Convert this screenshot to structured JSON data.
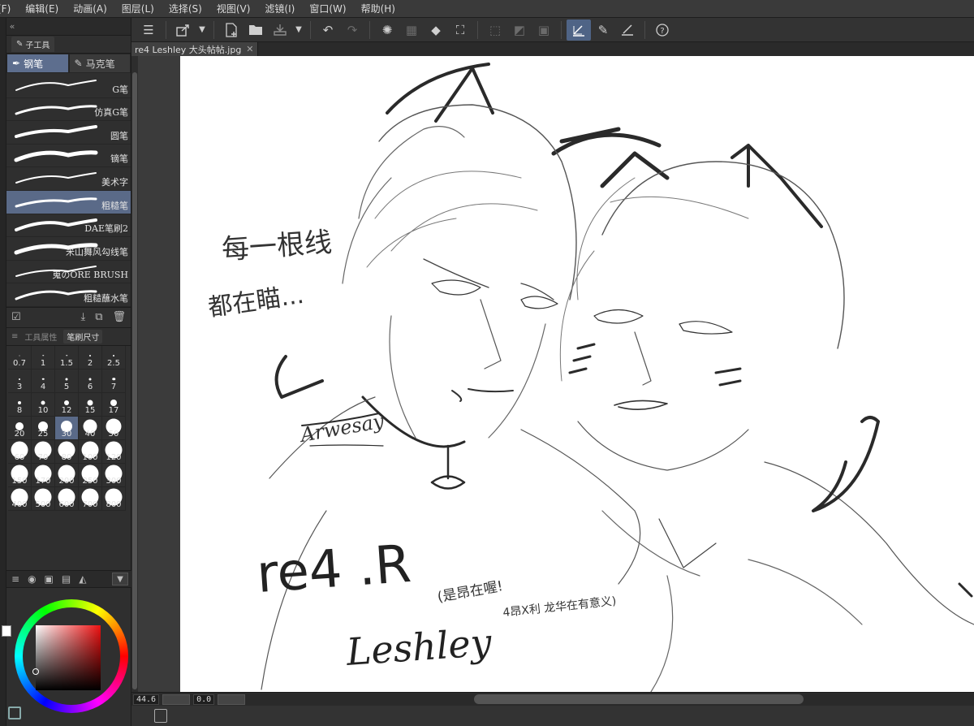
{
  "menubar": {
    "items": [
      "(F)",
      "编辑(E)",
      "动画(A)",
      "图层(L)",
      "选择(S)",
      "视图(V)",
      "滤镜(I)",
      "窗口(W)",
      "帮助(H)"
    ]
  },
  "toolbar": {
    "icons": [
      "menu-icon",
      "export-icon",
      "dropdown-icon",
      "new-file-icon",
      "open-folder-icon",
      "save-icon",
      "dropdown-icon",
      "undo-icon",
      "redo-icon",
      "loading-icon",
      "transform-icon",
      "fill-icon",
      "crop-icon",
      "clear-selection-icon",
      "invert-icon",
      "border-icon",
      "pen-active-icon",
      "ink-icon",
      "stroke-icon",
      "help-icon"
    ]
  },
  "panel": {
    "collapse_label": "«",
    "subtool_tab": "子工具",
    "group_tabs": [
      {
        "label": "钢笔",
        "icon": "pen-nib-icon"
      },
      {
        "label": "马克笔",
        "icon": "marker-icon"
      }
    ],
    "brushes": [
      {
        "name": "G笔"
      },
      {
        "name": "仿真G笔"
      },
      {
        "name": "圆笔"
      },
      {
        "name": "镝笔"
      },
      {
        "name": "美术字"
      },
      {
        "name": "粗糙笔",
        "selected": true
      },
      {
        "name": "DAE笔刷2"
      },
      {
        "name": "米山舞风勾线笔"
      },
      {
        "name": "嵬のORE BRUSH"
      },
      {
        "name": "粗糙蘸水笔"
      }
    ],
    "size_head": {
      "tool_property": "工具属性",
      "brush_size": "笔刷尺寸"
    },
    "sizes": [
      {
        "label": "0.7",
        "d": 1
      },
      {
        "label": "1",
        "d": 1.5
      },
      {
        "label": "1.5",
        "d": 1.5
      },
      {
        "label": "2",
        "d": 2
      },
      {
        "label": "2.5",
        "d": 2
      },
      {
        "label": "3",
        "d": 2
      },
      {
        "label": "4",
        "d": 2.5
      },
      {
        "label": "5",
        "d": 3
      },
      {
        "label": "6",
        "d": 3
      },
      {
        "label": "7",
        "d": 3.5
      },
      {
        "label": "8",
        "d": 4
      },
      {
        "label": "10",
        "d": 5
      },
      {
        "label": "12",
        "d": 6
      },
      {
        "label": "15",
        "d": 7
      },
      {
        "label": "17",
        "d": 8
      },
      {
        "label": "20",
        "d": 10
      },
      {
        "label": "25",
        "d": 12
      },
      {
        "label": "30",
        "d": 14,
        "selected": true
      },
      {
        "label": "40",
        "d": 17
      },
      {
        "label": "50",
        "d": 19
      },
      {
        "label": "60",
        "d": 21
      },
      {
        "label": "70",
        "d": 21
      },
      {
        "label": "80",
        "d": 21
      },
      {
        "label": "100",
        "d": 21
      },
      {
        "label": "120",
        "d": 21
      },
      {
        "label": "150",
        "d": 21
      },
      {
        "label": "170",
        "d": 21
      },
      {
        "label": "200",
        "d": 21
      },
      {
        "label": "250",
        "d": 21
      },
      {
        "label": "300",
        "d": 21
      },
      {
        "label": "400",
        "d": 21
      },
      {
        "label": "500",
        "d": 21
      },
      {
        "label": "600",
        "d": 21
      },
      {
        "label": "700",
        "d": 21
      },
      {
        "label": "800",
        "d": 21
      }
    ]
  },
  "document": {
    "tab_title": "re4 Leshley 大头帖帖.jpg",
    "close": "✕"
  },
  "status": {
    "zoom": "44.6",
    "rotation": "0.0"
  },
  "colors": {
    "accent": "#5a6a88",
    "foreground": "#ffffff"
  },
  "canvas_text": {
    "line1": "每一根线",
    "line2": "都在瞄...",
    "signature": "Arwesay",
    "title1": "re4 .R",
    "title2": "Leshley",
    "note1": "(是昂在喔!",
    "note2": "4昂X利 龙华在有意义)"
  }
}
